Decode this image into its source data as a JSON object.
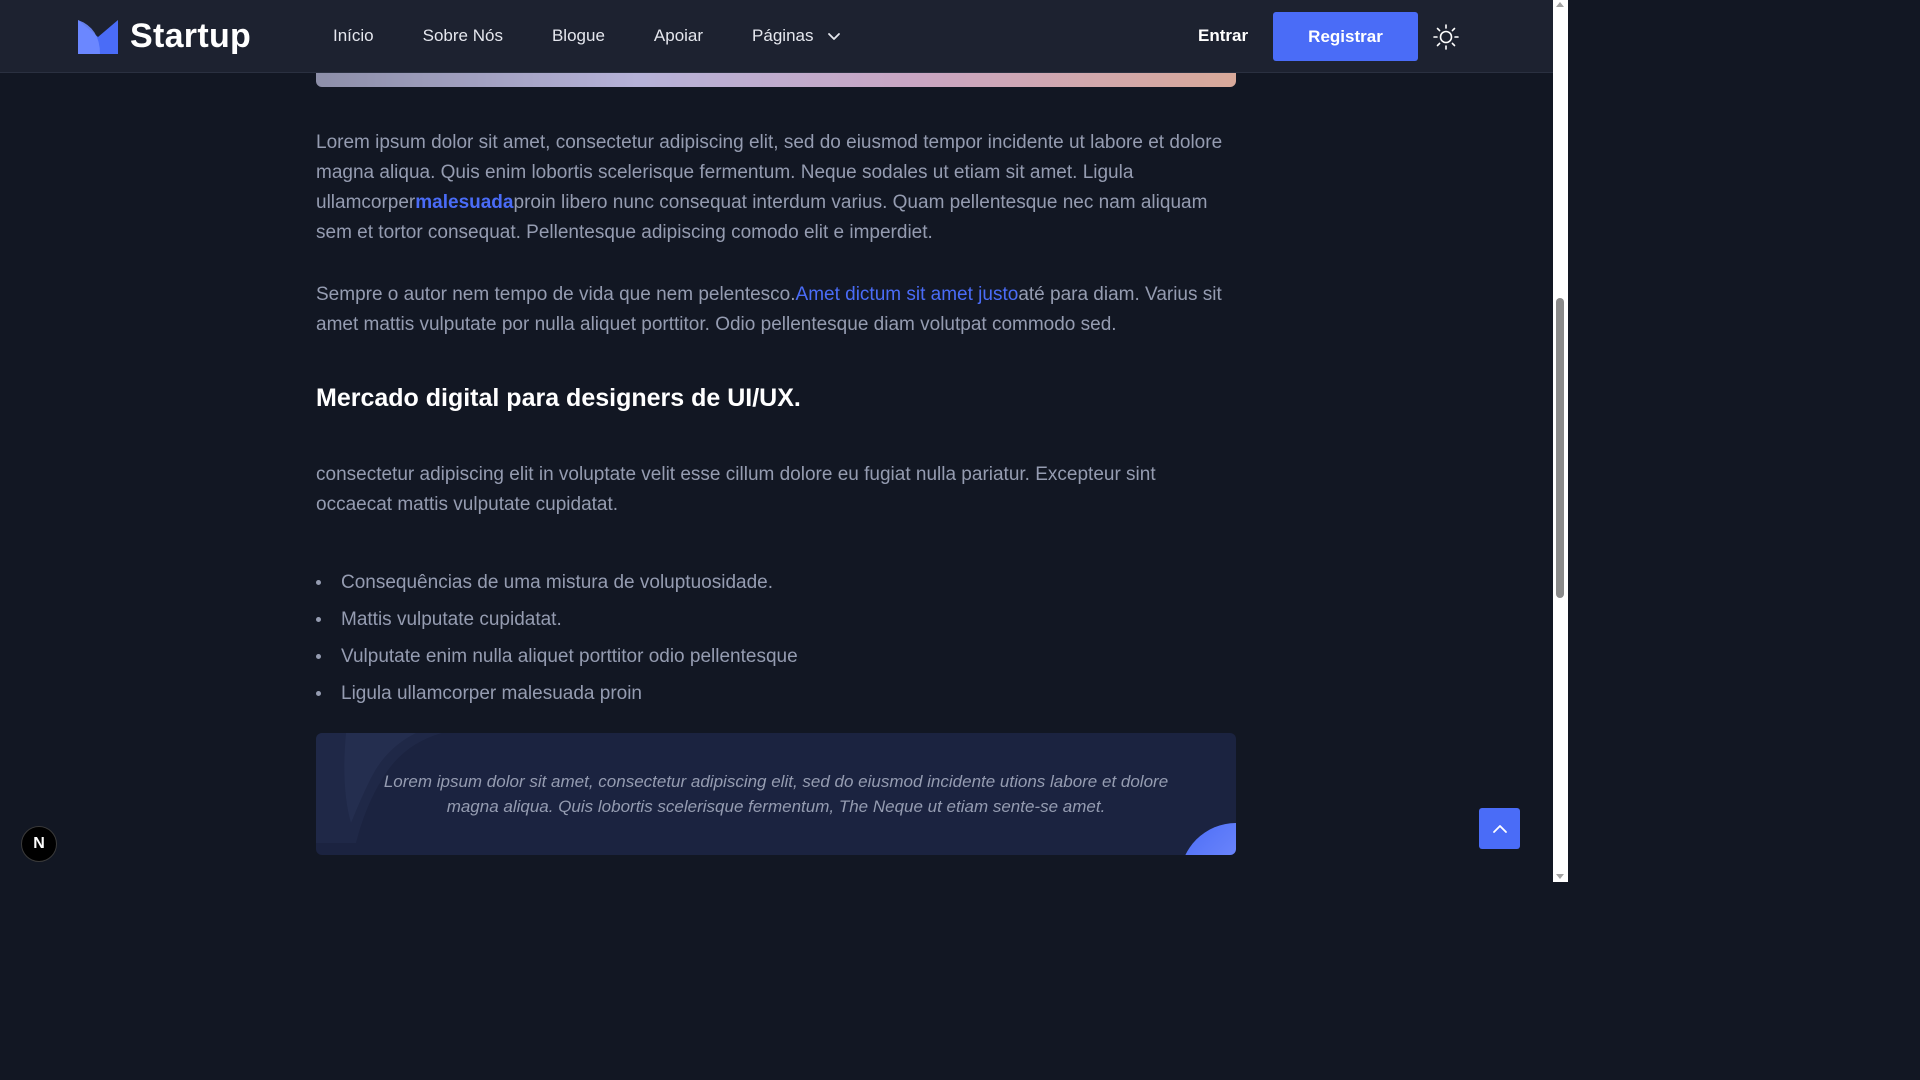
{
  "header": {
    "logo_text": "Startup",
    "nav": [
      {
        "label": "Início"
      },
      {
        "label": "Sobre Nós"
      },
      {
        "label": "Blogue"
      },
      {
        "label": "Apoiar"
      },
      {
        "label": "Páginas"
      }
    ],
    "signin_label": "Entrar",
    "register_label": "Registrar"
  },
  "article": {
    "p1": {
      "before": "Lorem ipsum dolor sit amet, consectetur adipiscing elit, sed do eiusmod tempor incidente ut labore et dolore magna aliqua. Quis enim lobortis scelerisque fermentum. Neque sodales ut etiam sit amet. Ligula ullamcorper",
      "link": "malesuada",
      "after": "proin libero nunc consequat interdum varius. Quam pellentesque nec nam aliquam sem et tortor consequat. Pellentesque adipiscing comodo elit e imperdiet."
    },
    "p2": {
      "before": "Sempre o autor nem tempo de vida que nem pelentesco.",
      "link": "Amet dictum sit amet justo",
      "after": "até para diam. Varius sit amet mattis vulputate por nulla aliquet porttitor. Odio pellentesque diam volutpat commodo sed."
    },
    "heading": "Mercado digital para designers de UI/UX.",
    "p3": "consectetur adipiscing elit in voluptate velit esse cillum dolore eu fugiat nulla pariatur. Excepteur sint occaecat mattis vulputate cupidatat.",
    "list": [
      "Consequências de uma mistura de voluptuosidade.",
      "Mattis vulputate cupidatat.",
      "Vulputate enim nulla aliquet porttitor odio pellentesque",
      "Ligula ullamcorper malesuada proin"
    ],
    "quote": "Lorem ipsum dolor sit amet, consectetur adipiscing elit, sed do eiusmod incidente utions labore et dolore magna aliqua. Quis lobortis scelerisque fermentum, The Neque ut etiam sente-se amet."
  },
  "badge_letter": "N",
  "colors": {
    "primary": "#4a6cf7",
    "background": "#121723",
    "header_bg": "#1d2230",
    "body_text": "#959cb1",
    "quote_bg": "#1b2340"
  },
  "icons": [
    "logo-mark-icon",
    "chevron-down-icon",
    "sun-icon",
    "chevron-up-icon"
  ]
}
